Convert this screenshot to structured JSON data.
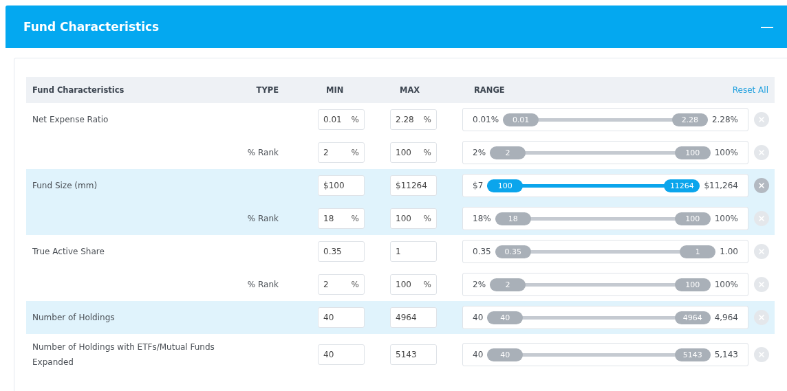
{
  "panel": {
    "title": "Fund Characteristics",
    "collapse_symbol": "—"
  },
  "table": {
    "columns": [
      "Fund Characteristics",
      "TYPE",
      "MIN",
      "MAX",
      "RANGE"
    ],
    "reset_label": "Reset All",
    "groups": [
      {
        "name": "Net Expense Ratio",
        "highlighted": false,
        "rows": [
          {
            "type": "",
            "min": "0.01",
            "min_unit": "%",
            "max": "2.28",
            "max_unit": "%",
            "low_label": "0.01%",
            "low_thumb": "0.01",
            "high_thumb": "2.28",
            "high_label": "2.28%",
            "active": false
          },
          {
            "type": "% Rank",
            "min": "2",
            "min_unit": "%",
            "max": "100",
            "max_unit": "%",
            "low_label": "2%",
            "low_thumb": "2",
            "high_thumb": "100",
            "high_label": "100%",
            "active": false
          }
        ]
      },
      {
        "name": "Fund Size (mm)",
        "highlighted": true,
        "rows": [
          {
            "type": "",
            "min": "$100",
            "max": "$11264",
            "low_label": "$7",
            "low_thumb": "100",
            "high_thumb": "11264",
            "high_label": "$11,264",
            "active": true
          },
          {
            "type": "% Rank",
            "min": "18",
            "min_unit": "%",
            "max": "100",
            "max_unit": "%",
            "low_label": "18%",
            "low_thumb": "18",
            "high_thumb": "100",
            "high_label": "100%",
            "active": false
          }
        ]
      },
      {
        "name": "True Active Share",
        "highlighted": false,
        "rows": [
          {
            "type": "",
            "min": "0.35",
            "max": "1",
            "low_label": "0.35",
            "low_thumb": "0.35",
            "high_thumb": "1",
            "high_label": "1.00",
            "active": false
          },
          {
            "type": "% Rank",
            "min": "2",
            "min_unit": "%",
            "max": "100",
            "max_unit": "%",
            "low_label": "2%",
            "low_thumb": "2",
            "high_thumb": "100",
            "high_label": "100%",
            "active": false
          }
        ]
      },
      {
        "name": "Number of Holdings",
        "highlighted": true,
        "rows": [
          {
            "type": "",
            "min": "40",
            "max": "4964",
            "low_label": "40",
            "low_thumb": "40",
            "high_thumb": "4964",
            "high_label": "4,964",
            "active": false
          }
        ]
      },
      {
        "name": "Number of Holdings with ETFs/Mutual Funds Expanded",
        "highlighted": false,
        "rows": [
          {
            "type": "",
            "min": "40",
            "max": "5143",
            "low_label": "40",
            "low_thumb": "40",
            "high_thumb": "5143",
            "high_label": "5,143",
            "active": false
          }
        ]
      }
    ]
  }
}
